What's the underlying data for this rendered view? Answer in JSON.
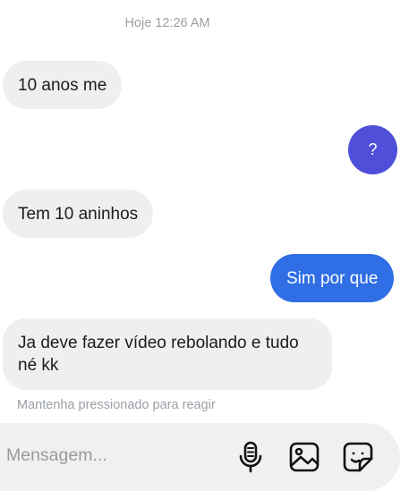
{
  "chat": {
    "timestamp": "Hoje 12:26 AM",
    "messages": [
      {
        "direction": "incoming",
        "text": "10 anos me"
      },
      {
        "direction": "outgoing",
        "text": "?"
      },
      {
        "direction": "incoming",
        "text": "Tem 10 aninhos"
      },
      {
        "direction": "outgoing",
        "text": "Sim por que"
      },
      {
        "direction": "incoming",
        "text": "Ja deve fazer vídeo rebolando e tudo né kk"
      }
    ],
    "reaction_hint": "Mantenha pressionado para reagir"
  },
  "composer": {
    "placeholder": "Mensagem...",
    "value": "",
    "icons": [
      "microphone-icon",
      "gallery-icon",
      "sticker-icon"
    ]
  },
  "colors": {
    "incoming_bubble": "#efefef",
    "outgoing_bubble": "#2f6ee5",
    "question_bubble": "#4f4fd9",
    "muted_text": "#9aa0a6",
    "composer_bg": "#f0f0f0"
  }
}
